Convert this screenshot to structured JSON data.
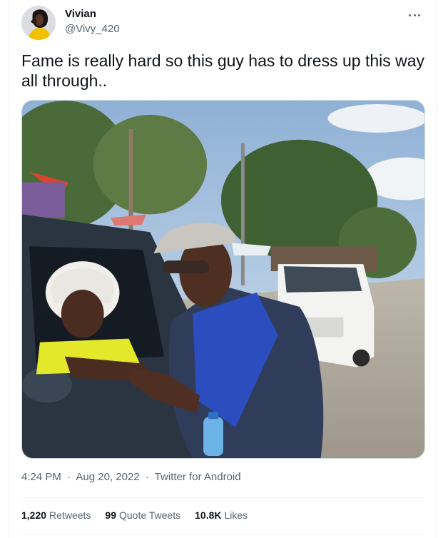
{
  "author": {
    "name": "Vivian",
    "handle": "@Vivy_420",
    "avatar_icon": "avatar-photo"
  },
  "more_icon": "more-horizontal-icon",
  "tweet": {
    "text": "Fame is really hard so this guy has to dress up this way all through.."
  },
  "media": {
    "type": "photo"
  },
  "meta": {
    "time": "4:24 PM",
    "separator": "·",
    "date": "Aug 20, 2022",
    "source": "Twitter for Android"
  },
  "stats": {
    "retweets_count": "1,220",
    "retweets_label": "Retweets",
    "quotes_count": "99",
    "quotes_label": "Quote Tweets",
    "likes_count": "10.8K",
    "likes_label": "Likes"
  },
  "colors": {
    "text_primary": "#0f1419",
    "text_secondary": "#536471",
    "border": "#eff3f4"
  }
}
